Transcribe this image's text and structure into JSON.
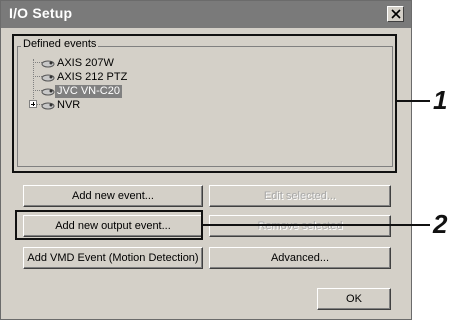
{
  "window": {
    "title": "I/O Setup"
  },
  "group": {
    "label": "Defined events"
  },
  "tree": {
    "items": [
      {
        "label": "AXIS 207W",
        "selected": false
      },
      {
        "label": "AXIS 212 PTZ",
        "selected": false
      },
      {
        "label": "JVC VN-C20",
        "selected": true
      },
      {
        "label": "NVR",
        "selected": false,
        "expandable": true
      }
    ]
  },
  "buttons": {
    "add_new_event": "Add new event...",
    "edit_selected": "Edit selected...",
    "add_new_output_event": "Add new output event...",
    "remove_selected": "Remove selected",
    "add_vmd_event": "Add VMD Event (Motion Detection)",
    "advanced": "Advanced...",
    "ok": "OK"
  },
  "callouts": {
    "one": "1",
    "two": "2"
  },
  "colors": {
    "title_bar": "#7a7a7a",
    "dialog_bg": "#d4d0c8",
    "selection": "#808080"
  }
}
